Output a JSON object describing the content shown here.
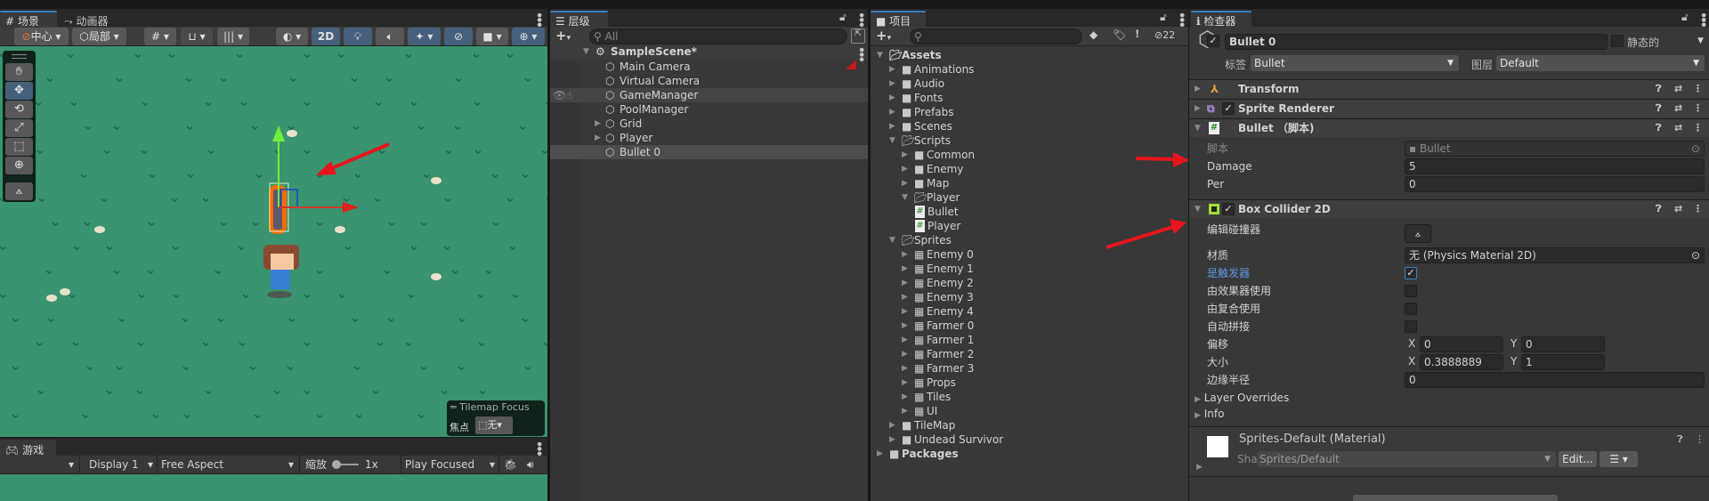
{
  "colors": {
    "accent": "#3a7fc9",
    "scene_bg": "#39946f",
    "selection": "#4d4d4d",
    "annotation": "#e8141c",
    "trigger_label": "#5b9be6"
  },
  "scene": {
    "tabs": [
      {
        "label": "场景",
        "icon": "grid-icon"
      },
      {
        "label": "动画器",
        "icon": "animator-icon"
      }
    ],
    "toolbar": {
      "pivot": "中心",
      "space": "局部",
      "mode_2d": "2D"
    },
    "tools": [
      "hand-tool",
      "move-tool",
      "rotate-tool",
      "scale-tool",
      "rect-tool",
      "transform-tool",
      "edit-collider-tool"
    ],
    "active_tool": "move-tool",
    "overlay": {
      "title": "Tilemap Focus",
      "focus_label": "焦点",
      "focus_value": "无"
    }
  },
  "game": {
    "tab": "游戏",
    "display": "Display 1",
    "aspect": "Free Aspect",
    "scale_label": "缩放",
    "scale_value": "1x",
    "play_mode": "Play Focused"
  },
  "hierarchy": {
    "tab": "层级",
    "search_placeholder": "All",
    "scene": "SampleScene*",
    "items": [
      {
        "label": "Main Camera",
        "expandable": false
      },
      {
        "label": "Virtual Camera",
        "expandable": false
      },
      {
        "label": "GameManager",
        "expandable": false,
        "hovered": true
      },
      {
        "label": "PoolManager",
        "expandable": false
      },
      {
        "label": "Grid",
        "expandable": true
      },
      {
        "label": "Player",
        "expandable": true
      },
      {
        "label": "Bullet 0",
        "expandable": false,
        "selected": true
      }
    ]
  },
  "project": {
    "tab": "项目",
    "hidden_count": "22",
    "tree": [
      {
        "label": "Assets",
        "depth": 0,
        "type": "folder",
        "expanded": true,
        "bold": true
      },
      {
        "label": "Animations",
        "depth": 1,
        "type": "folder"
      },
      {
        "label": "Audio",
        "depth": 1,
        "type": "folder"
      },
      {
        "label": "Fonts",
        "depth": 1,
        "type": "folder"
      },
      {
        "label": "Prefabs",
        "depth": 1,
        "type": "folder"
      },
      {
        "label": "Scenes",
        "depth": 1,
        "type": "folder"
      },
      {
        "label": "Scripts",
        "depth": 1,
        "type": "folder",
        "expanded": true
      },
      {
        "label": "Common",
        "depth": 2,
        "type": "folder"
      },
      {
        "label": "Enemy",
        "depth": 2,
        "type": "folder"
      },
      {
        "label": "Map",
        "depth": 2,
        "type": "folder"
      },
      {
        "label": "Player",
        "depth": 2,
        "type": "folder",
        "expanded": true
      },
      {
        "label": "Bullet",
        "depth": 3,
        "type": "script"
      },
      {
        "label": "Player",
        "depth": 3,
        "type": "script"
      },
      {
        "label": "Sprites",
        "depth": 1,
        "type": "folder",
        "expanded": true
      },
      {
        "label": "Enemy 0",
        "depth": 2,
        "type": "sprite"
      },
      {
        "label": "Enemy 1",
        "depth": 2,
        "type": "sprite"
      },
      {
        "label": "Enemy 2",
        "depth": 2,
        "type": "sprite"
      },
      {
        "label": "Enemy 3",
        "depth": 2,
        "type": "sprite"
      },
      {
        "label": "Enemy 4",
        "depth": 2,
        "type": "sprite"
      },
      {
        "label": "Farmer 0",
        "depth": 2,
        "type": "sprite"
      },
      {
        "label": "Farmer 1",
        "depth": 2,
        "type": "sprite"
      },
      {
        "label": "Farmer 2",
        "depth": 2,
        "type": "sprite"
      },
      {
        "label": "Farmer 3",
        "depth": 2,
        "type": "sprite"
      },
      {
        "label": "Props",
        "depth": 2,
        "type": "sprite"
      },
      {
        "label": "Tiles",
        "depth": 2,
        "type": "sprite"
      },
      {
        "label": "UI",
        "depth": 2,
        "type": "sprite"
      },
      {
        "label": "TileMap",
        "depth": 1,
        "type": "folder"
      },
      {
        "label": "Undead Survivor",
        "depth": 1,
        "type": "folder"
      },
      {
        "label": "Packages",
        "depth": 0,
        "type": "folder",
        "bold": true
      }
    ]
  },
  "inspector": {
    "tab": "检查器",
    "object_name": "Bullet 0",
    "active": true,
    "static_label": "静态的",
    "static": false,
    "tag_label": "标签",
    "tag": "Bullet",
    "layer_label": "图层",
    "layer": "Default",
    "components": {
      "transform": "Transform",
      "sprite_renderer": "Sprite Renderer",
      "script": {
        "title": "Bullet （脚本)",
        "script_label": "脚本",
        "script_value": "Bullet",
        "fields": [
          {
            "label": "Damage",
            "value": "5"
          },
          {
            "label": "Per",
            "value": "0"
          }
        ]
      },
      "box_collider": {
        "title": "Box Collider 2D",
        "edit_label": "编辑碰撞器",
        "material_label": "材质",
        "material_value": "无 (Physics Material 2D)",
        "is_trigger_label": "是触发器",
        "is_trigger": true,
        "used_by_effector_label": "由效果器使用",
        "used_by_effector": false,
        "used_by_composite_label": "由复合使用",
        "used_by_composite": false,
        "auto_tiling_label": "自动拼接",
        "auto_tiling": false,
        "offset_label": "偏移",
        "offset_x": "0",
        "offset_y": "0",
        "size_label": "大小",
        "size_x": "0.3888889",
        "size_y": "1",
        "edge_radius_label": "边缘半径",
        "edge_radius": "0",
        "x_label": "X",
        "y_label": "Y",
        "layer_overrides": "Layer Overrides",
        "info": "Info"
      }
    },
    "material": {
      "title": "Sprites-Default (Material)",
      "shader_label": "Shader",
      "shader": "Sprites/Default",
      "edit": "Edit..."
    }
  }
}
